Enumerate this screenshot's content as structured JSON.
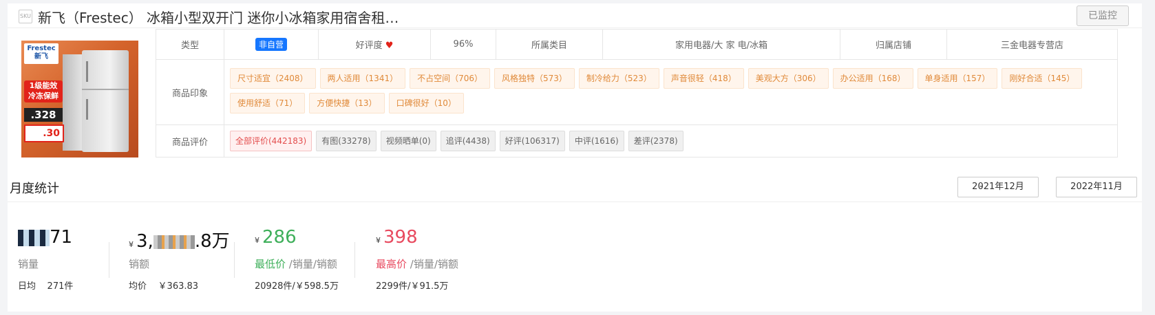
{
  "header": {
    "sku_icon": "sku-icon",
    "sku_text": "SKU",
    "title": "新飞（Frestec） 冰箱小型双开门 迷你小冰箱家用宿舍租…",
    "monitor_btn": "已监控"
  },
  "product_image": {
    "brand": "Frestec",
    "brand_cn": "新飞",
    "badge_line1": "1级能效",
    "badge_line2": "冷冻保鲜",
    "price_text": ".328",
    "coupon_text": ".30"
  },
  "info": {
    "type_label": "类型",
    "type_value": "非自营",
    "rating_label": "好评度",
    "rating_value": "96%",
    "category_label": "所属类目",
    "category_value": "家用电器/大 家 电/冰箱",
    "store_label": "归属店铺",
    "store_value": "三金电器专营店",
    "impression_label": "商品印象",
    "impressions": [
      "尺寸适宜（2408）",
      "两人适用（1341）",
      "不占空间（706）",
      "风格独特（573）",
      "制冷给力（523）",
      "声音很轻（418）",
      "美观大方（306）",
      "办公适用（168）",
      "单身适用（157）",
      "刚好合适（145）",
      "使用舒适（71）",
      "方便快捷（13）",
      "口碑很好（10）"
    ],
    "review_label": "商品评价",
    "reviews": [
      "全部评价(442183)",
      "有图(33278)",
      "视频晒单(0)",
      "追评(4438)",
      "好评(106317)",
      "中评(1616)",
      "差评(2378)"
    ]
  },
  "monthly": {
    "title": "月度统计",
    "date_start": "2021年12月",
    "date_sep": "-",
    "date_end": "2022年11月",
    "sales": {
      "value_visible": "71",
      "label": "销量",
      "daily_label": "日均",
      "daily_value": "271件"
    },
    "revenue": {
      "currency": "¥",
      "value_prefix": "3,",
      "value_suffix": ".8万",
      "label": "销额",
      "avg_label": "均价",
      "avg_value": "￥363.83"
    },
    "min_price": {
      "currency": "¥",
      "value": "286",
      "label_main": "最低价",
      "label_rest": " /销量/销额",
      "detail": "20928件/￥598.5万"
    },
    "max_price": {
      "currency": "¥",
      "value": "398",
      "label_main": "最高价",
      "label_rest": " /销量/销额",
      "detail": "2299件/￥91.5万"
    }
  },
  "colors": {
    "accent_blue": "#1677ff",
    "green": "#3eaf5a",
    "red": "#e84a5f",
    "orange_tag": "#e08a3a"
  }
}
